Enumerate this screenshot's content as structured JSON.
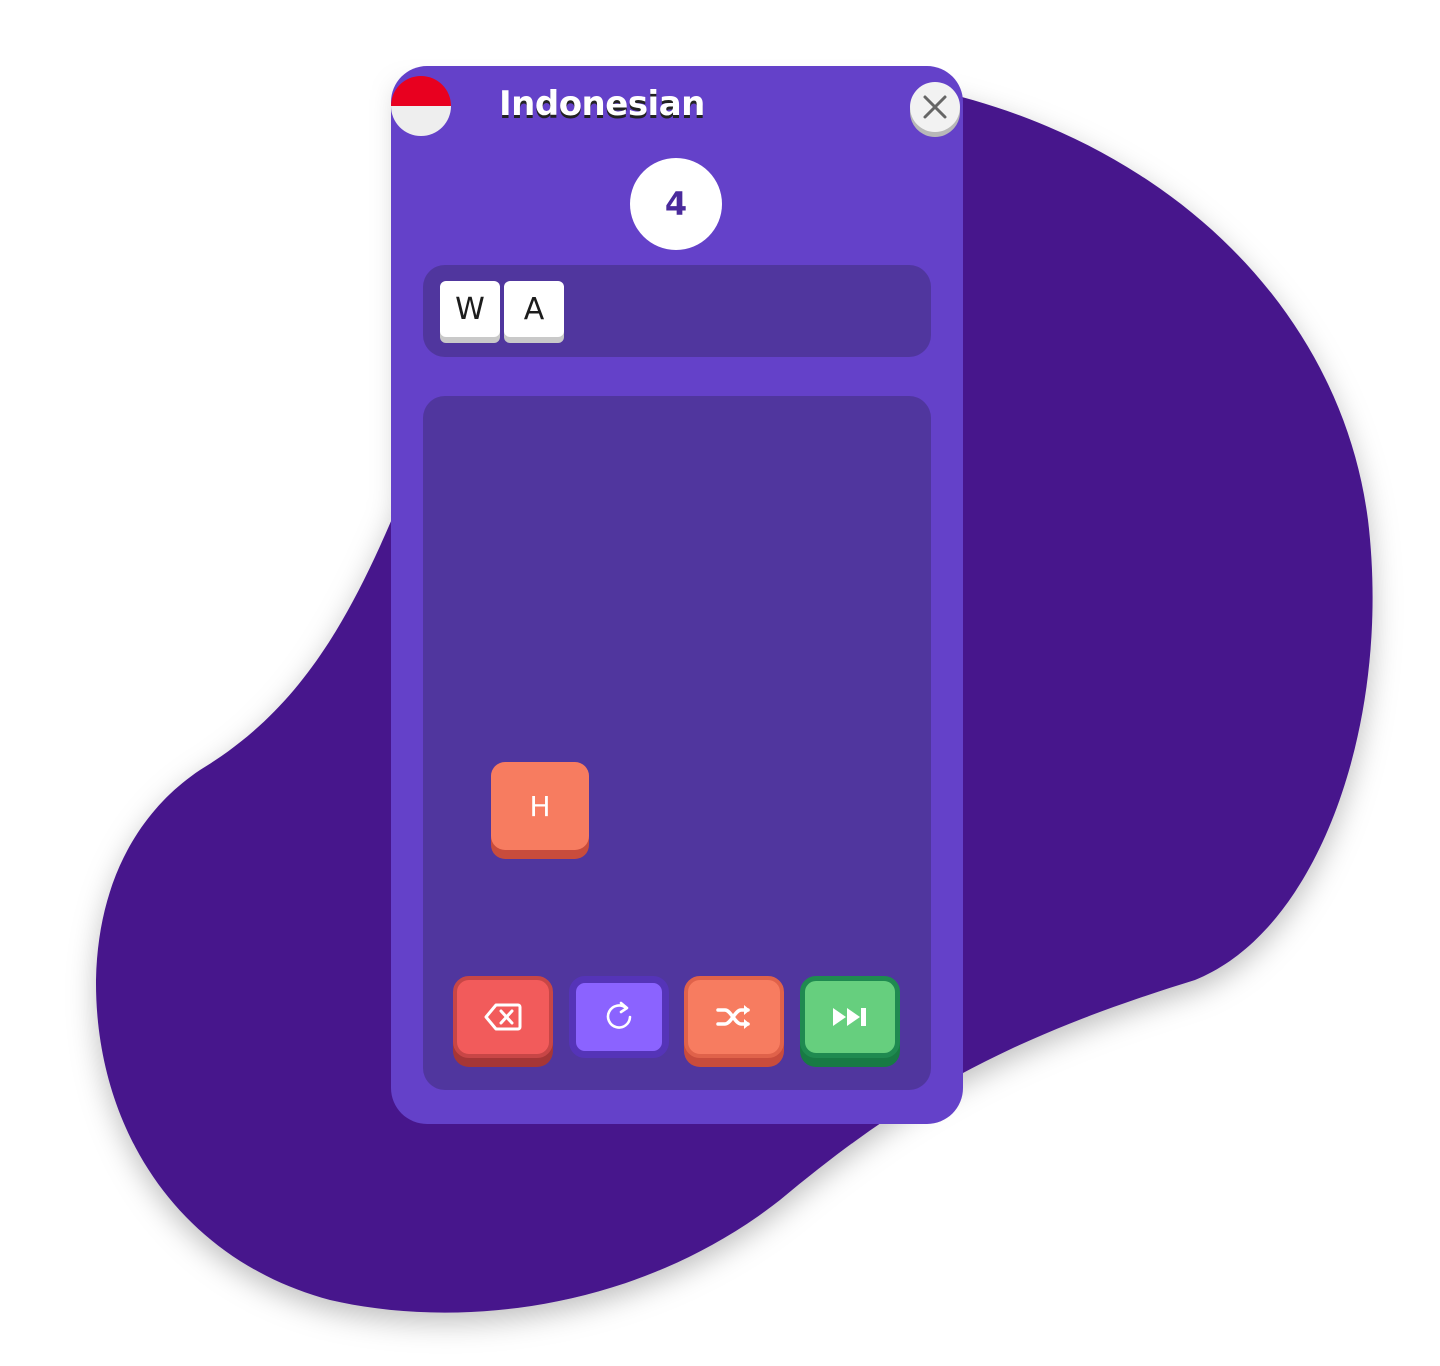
{
  "header": {
    "language": "Indonesian",
    "flag": "indonesia-flag",
    "close_icon": "close-icon"
  },
  "counter": {
    "value": "4"
  },
  "answer": {
    "letters": [
      "W",
      "A"
    ]
  },
  "board": {
    "tiles": [
      "H"
    ]
  },
  "controls": {
    "delete_icon": "backspace-icon",
    "reset_icon": "redo-icon",
    "shuffle_icon": "shuffle-icon",
    "skip_icon": "skip-forward-icon"
  },
  "colors": {
    "background_blob": "#47178c",
    "card": "#6441c9",
    "panel": "#50369e",
    "tile_orange": "#f77c60",
    "delete_red": "#f25b5b",
    "reset_purple": "#8b63ff",
    "skip_green": "#66cf7e",
    "flag_red": "#e8001f",
    "flag_white": "#eeeeee"
  }
}
